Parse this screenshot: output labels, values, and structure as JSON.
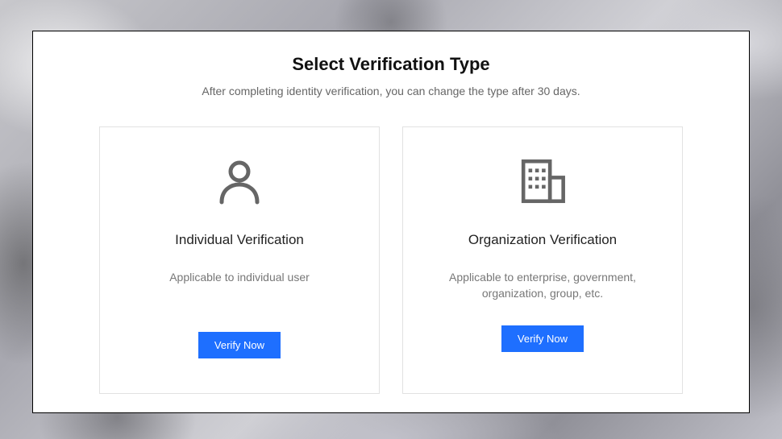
{
  "header": {
    "title": "Select Verification Type",
    "subtitle": "After completing identity verification, you can change the type after 30 days."
  },
  "cards": {
    "individual": {
      "icon": "person-icon",
      "title": "Individual Verification",
      "description": "Applicable to individual user",
      "button_label": "Verify Now"
    },
    "organization": {
      "icon": "building-icon",
      "title": "Organization Verification",
      "description": "Applicable to enterprise, government, organization, group, etc.",
      "button_label": "Verify Now"
    }
  },
  "colors": {
    "accent": "#1e6fff",
    "icon_stroke": "#666666"
  }
}
